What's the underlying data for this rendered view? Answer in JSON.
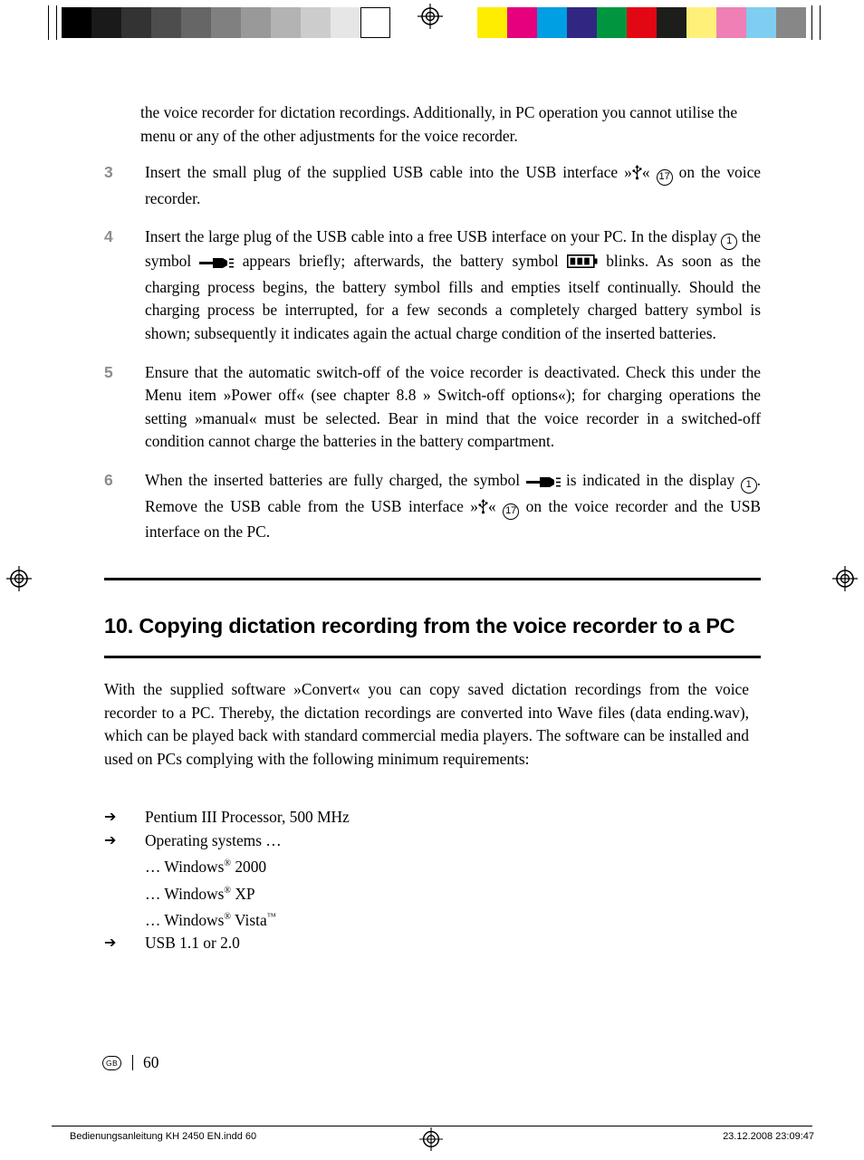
{
  "page": {
    "intro_paragraph": "the voice recorder for dictation recordings. Additionally, in PC operation you cannot utilise the menu or any of the other adjustments for the voice recorder.",
    "steps": [
      {
        "number": "3",
        "text_before": "Insert the small plug of the supplied USB cable into the USB interface »",
        "icon": "usb-icon",
        "text_mid": "« ",
        "callout": "17",
        "text_after": " on the voice recorder."
      },
      {
        "number": "4",
        "text_1": "Insert the large plug of the USB cable into a free USB interface on your PC. In the display ",
        "callout_1": "1",
        "text_2": " the symbol ",
        "icon_1": "plug-charging-icon",
        "text_3": " appears briefly; afterwards, the battery symbol ",
        "icon_2": "battery-icon",
        "text_4": " blinks. As soon as the charging process begins, the battery symbol fills and empties itself continually. Should the charging process be interrupted, for a few seconds a completely charged battery symbol is shown; subsequently it indicates again the actual charge condition of the inserted batteries."
      },
      {
        "number": "5",
        "text": "Ensure that the automatic switch-off of the voice recorder is deactivated. Check this under the Menu item »Power off« (see chapter 8.8 » Switch-off options«); for charging operations the setting »manual« must be selected. Bear in mind that the voice recorder in a switched-off condition cannot charge the batteries in the battery compartment."
      },
      {
        "number": "6",
        "text_1": "When the inserted batteries are fully charged, the symbol ",
        "icon_1": "plug-charging-icon",
        "text_2": " is indicated in the display ",
        "callout_1": "1",
        "text_3": ". Remove the USB cable from the USB interface »",
        "icon_2": "usb-icon",
        "text_4": "« ",
        "callout_2": "17",
        "text_5": " on the voice recorder and the USB interface on the PC."
      }
    ],
    "section_heading": "10. Copying dictation recording from the voice recorder to a PC",
    "section_body": "With the supplied software »Convert« you can copy saved dictation recordings from the voice recorder to a PC. Thereby, the dictation recordings are converted into Wave files (data ending.wav), which can be played back with standard commercial media players. The software can be installed and used on PCs complying with the following minimum requirements:",
    "bullets": [
      {
        "marker": "arrow-right-icon",
        "text": "Pentium III Processor, 500 MHz"
      },
      {
        "marker": "arrow-right-icon",
        "text": "Operating systems …"
      },
      {
        "marker": "arrow-right-icon",
        "text": "USB 1.1 or 2.0"
      }
    ],
    "sub_items": [
      {
        "prefix": "… Windows",
        "sup": "®",
        "suffix": " 2000"
      },
      {
        "prefix": "… Windows",
        "sup": "®",
        "suffix": " XP"
      },
      {
        "prefix": "… Windows",
        "sup": "®",
        "suffix": " Vista",
        "sup2": "™"
      }
    ],
    "folio": {
      "locale_badge": "GB",
      "page_number": "60"
    },
    "footer": {
      "left": "Bedienungsanleitung KH 2450 EN.indd   60",
      "right": "23.12.2008   23:09:47"
    }
  },
  "print_marks": {
    "grayscale_swatches": [
      "#000000",
      "#1a1a1a",
      "#333333",
      "#4d4d4d",
      "#666666",
      "#808080",
      "#999999",
      "#b3b3b3",
      "#cccccc",
      "#e6e6e6",
      "#ffffff"
    ],
    "color_swatches": [
      "#ffed00",
      "#e6007e",
      "#009ee3",
      "#312783",
      "#009640",
      "#e30613",
      "#1d1d1b",
      "#fff07a",
      "#ef7fb5",
      "#7fcdf1",
      "#878787"
    ]
  }
}
